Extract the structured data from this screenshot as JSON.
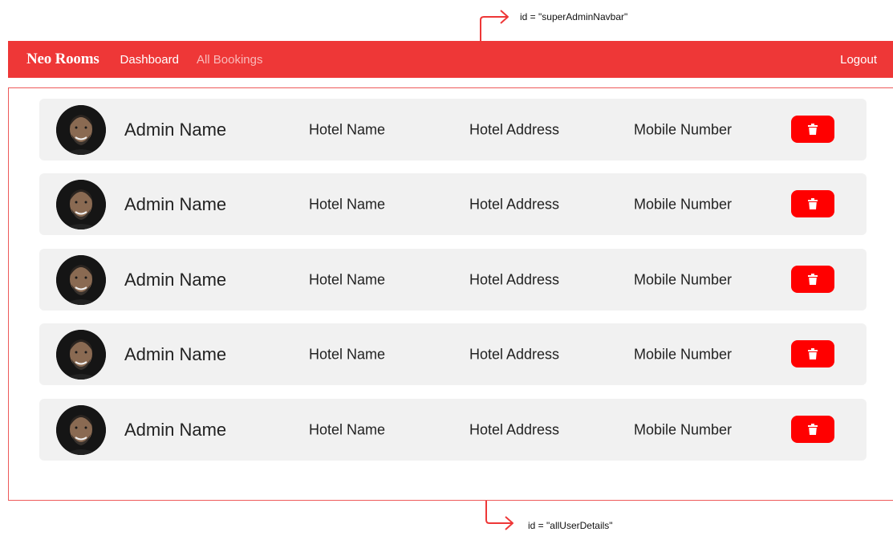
{
  "annotations": {
    "navbar_id_label": "id = \"superAdminNavbar\"",
    "details_id_label": "id = \"allUserDetails\""
  },
  "navbar": {
    "brand": "Neo Rooms",
    "links": [
      "Dashboard",
      "All Bookings"
    ],
    "logout": "Logout",
    "colors": {
      "background": "#ee3737",
      "active_link": "#ffffff",
      "inactive_link": "#f9b9b9"
    }
  },
  "users": [
    {
      "admin_name": "Admin Name",
      "hotel_name": "Hotel Name",
      "hotel_address": "Hotel Address",
      "mobile_number": "Mobile Number",
      "avatar_icon": "avatar",
      "action_icon": "trash-icon"
    },
    {
      "admin_name": "Admin Name",
      "hotel_name": "Hotel Name",
      "hotel_address": "Hotel Address",
      "mobile_number": "Mobile Number",
      "avatar_icon": "avatar",
      "action_icon": "trash-icon"
    },
    {
      "admin_name": "Admin Name",
      "hotel_name": "Hotel Name",
      "hotel_address": "Hotel Address",
      "mobile_number": "Mobile Number",
      "avatar_icon": "avatar",
      "action_icon": "trash-icon"
    },
    {
      "admin_name": "Admin Name",
      "hotel_name": "Hotel Name",
      "hotel_address": "Hotel Address",
      "mobile_number": "Mobile Number",
      "avatar_icon": "avatar",
      "action_icon": "trash-icon"
    },
    {
      "admin_name": "Admin Name",
      "hotel_name": "Hotel Name",
      "hotel_address": "Hotel Address",
      "mobile_number": "Mobile Number",
      "avatar_icon": "avatar",
      "action_icon": "trash-icon"
    }
  ],
  "colors": {
    "accent": "#ee3737",
    "delete_button": "#ff0000",
    "row_background": "#f1f1f1"
  }
}
